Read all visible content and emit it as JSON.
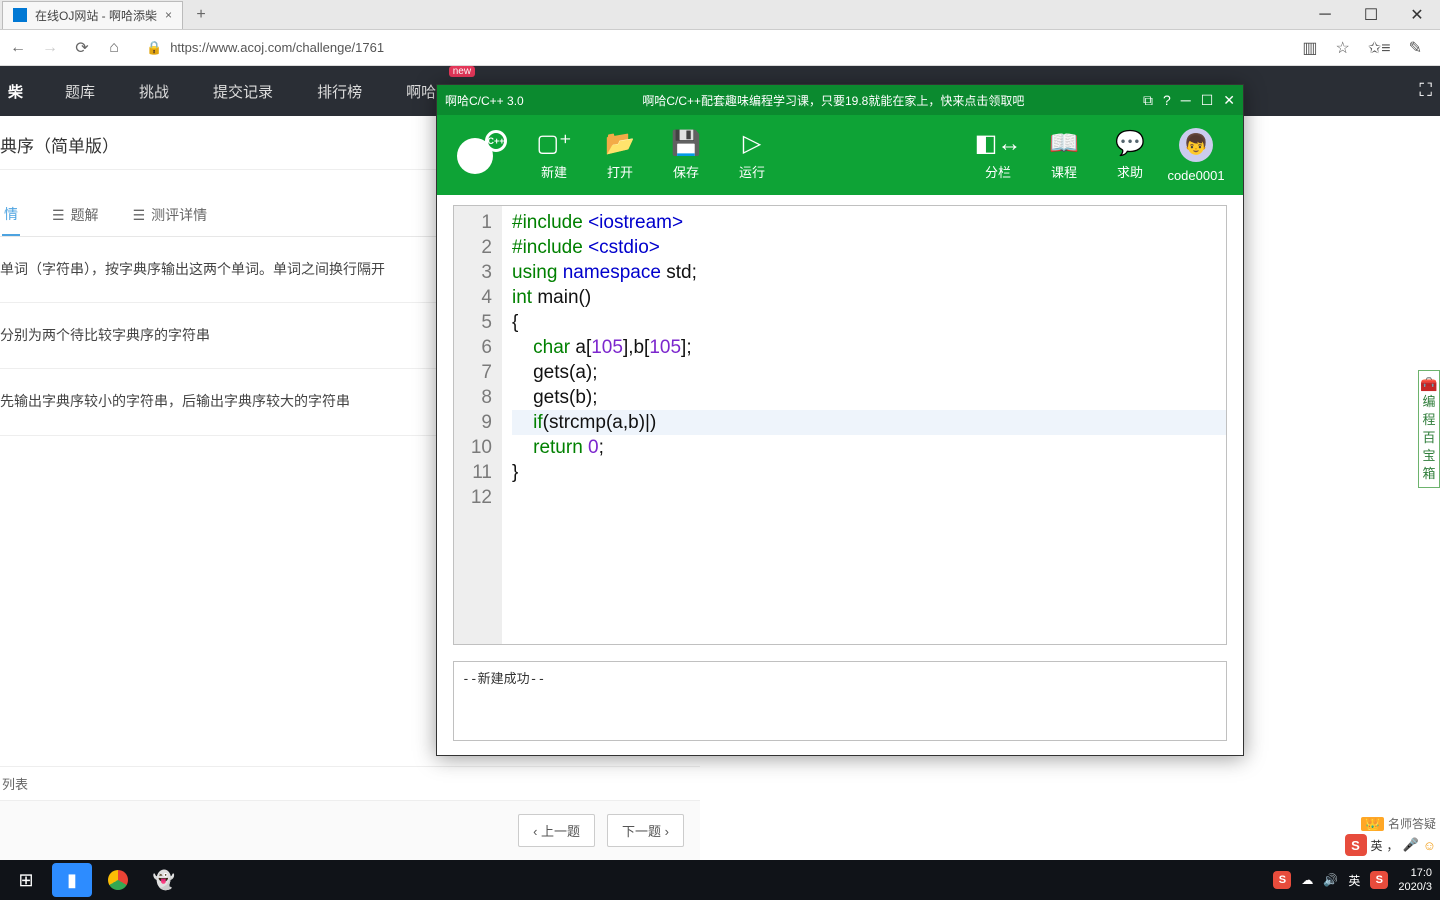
{
  "browser": {
    "tab_title": "在线OJ网站 - 啊哈添柴",
    "url": "https://www.acoj.com/challenge/1761"
  },
  "site_nav": {
    "brand": "柴",
    "items": [
      "题库",
      "挑战",
      "提交记录",
      "排行榜",
      "啊哈编"
    ],
    "new_badge": "new"
  },
  "page": {
    "title": "典序（简单版）",
    "tabs": [
      "情",
      "题解",
      "测评详情"
    ],
    "tab_icons": [
      "",
      "☰",
      "☰"
    ],
    "desc1": "单词（字符串），按字典序输出这两个单词。单词之间换行隔开",
    "desc2": "分别为两个待比较字典序的字符串",
    "desc3": "先输出字典序较小的字符串，后输出字典序较大的字符串",
    "list_label": "列表",
    "prev": "‹ 上一题",
    "next": "下一题 ›"
  },
  "ide": {
    "title": "啊哈C/C++ 3.0",
    "promo": "啊哈C/C++配套趣味编程学习课，只要19.8就能在家上，快来点击领取吧",
    "toolbar": {
      "new": "新建",
      "open": "打开",
      "save": "保存",
      "run": "运行",
      "split": "分栏",
      "course": "课程",
      "help": "求助",
      "user": "code0001"
    },
    "code": {
      "lines": [
        {
          "n": 1,
          "seg": [
            [
              "hl-green",
              "#include "
            ],
            [
              "hl-blue",
              "<iostream>"
            ]
          ]
        },
        {
          "n": 2,
          "seg": [
            [
              "hl-green",
              "#include "
            ],
            [
              "hl-blue",
              "<cstdio>"
            ]
          ]
        },
        {
          "n": 3,
          "seg": [
            [
              "hl-green",
              "using "
            ],
            [
              "hl-blue",
              "namespace "
            ],
            [
              "",
              "std;"
            ]
          ]
        },
        {
          "n": 4,
          "seg": [
            [
              "hl-green",
              "int "
            ],
            [
              "",
              "main()"
            ]
          ]
        },
        {
          "n": 5,
          "seg": [
            [
              "",
              "{"
            ]
          ]
        },
        {
          "n": 6,
          "seg": [
            [
              "",
              "    "
            ],
            [
              "hl-green",
              "char "
            ],
            [
              "",
              "a["
            ],
            [
              "hl-purple",
              "105"
            ],
            [
              "",
              "],b["
            ],
            [
              "hl-purple",
              "105"
            ],
            [
              "",
              "];"
            ]
          ]
        },
        {
          "n": 7,
          "seg": [
            [
              "",
              "    gets(a);"
            ]
          ]
        },
        {
          "n": 8,
          "seg": [
            [
              "",
              "    gets(b);"
            ]
          ]
        },
        {
          "n": 9,
          "hl": true,
          "seg": [
            [
              "",
              "    "
            ],
            [
              "hl-green",
              "if"
            ],
            [
              "",
              "(strcmp(a,b)|)"
            ]
          ]
        },
        {
          "n": 10,
          "seg": [
            [
              "",
              "    "
            ],
            [
              "hl-green",
              "return "
            ],
            [
              "hl-purple",
              "0"
            ],
            [
              "",
              ";"
            ]
          ]
        },
        {
          "n": 11,
          "seg": [
            [
              "",
              "}"
            ]
          ]
        },
        {
          "n": 12,
          "seg": [
            [
              "",
              ""
            ]
          ]
        }
      ]
    },
    "console": "--新建成功--"
  },
  "right_pin": "编程百宝箱",
  "teacher_hint": "名师答疑",
  "ime": {
    "lang": "英",
    "punct": "，",
    "half": "◐"
  },
  "taskbar": {
    "time": "17:0",
    "date": "2020/3",
    "tray_lang": "英"
  }
}
